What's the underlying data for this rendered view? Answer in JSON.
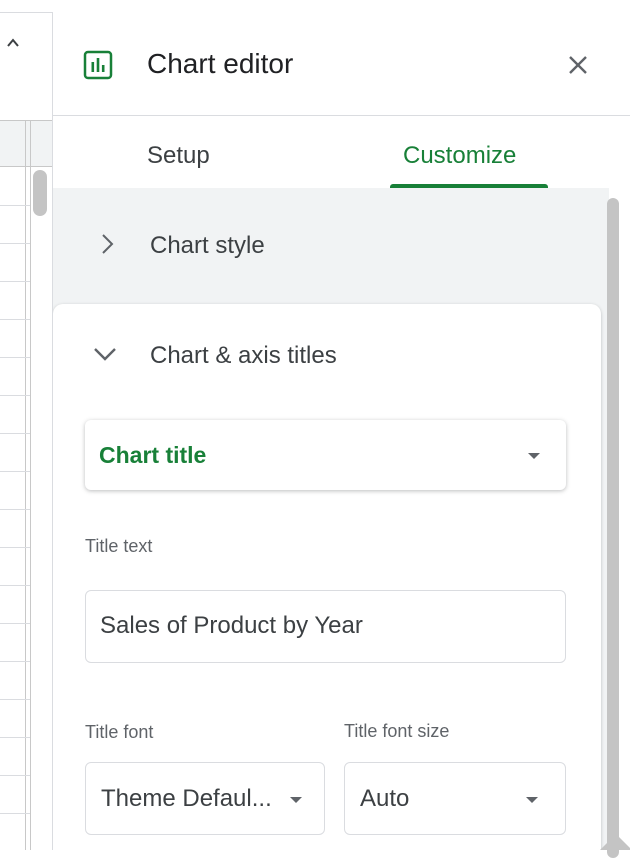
{
  "panel": {
    "title": "Chart editor",
    "tabs": [
      {
        "label": "Setup",
        "active": false
      },
      {
        "label": "Customize",
        "active": true
      }
    ]
  },
  "sections": {
    "chart_style": {
      "label": "Chart style",
      "expanded": false
    },
    "chart_axis_titles": {
      "label": "Chart & axis titles",
      "expanded": true,
      "title_type": "Chart title",
      "title_text_label": "Title text",
      "title_text_value": "Sales of Product by Year",
      "title_font_label": "Title font",
      "title_font_value": "Theme Defaul...",
      "title_font_size_label": "Title font size",
      "title_font_size_value": "Auto"
    }
  },
  "colors": {
    "accent_green": "#188038",
    "panel_background": "#f1f3f4",
    "divider": "#dadce0"
  },
  "icons": {
    "chart": "bar-chart-icon",
    "close": "close-icon",
    "collapsed": "chevron-right-icon",
    "expanded": "chevron-down-icon",
    "sheet_collapse": "chevron-up-icon"
  }
}
